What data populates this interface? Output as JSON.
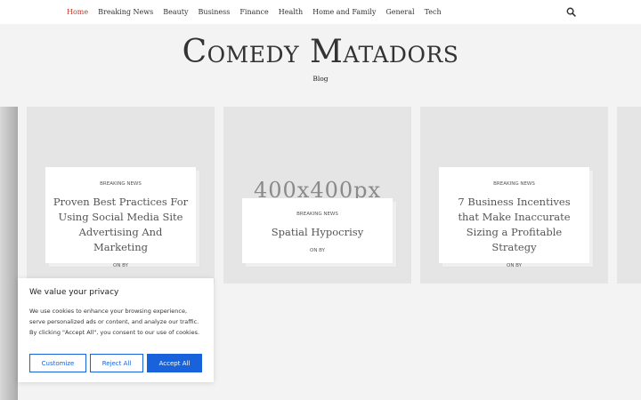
{
  "nav": {
    "items": [
      "Home",
      "Breaking News",
      "Beauty",
      "Business",
      "Finance",
      "Health",
      "Home and Family",
      "General",
      "Tech"
    ],
    "search_icon": "search-icon"
  },
  "site": {
    "title": "Comedy Matadors",
    "description": "Blog"
  },
  "posts": [
    {
      "category": "BREAKING NEWS",
      "title": "Proven Best Practices For Using Social Media Site Advertising And Marketing",
      "meta": "ON BY"
    },
    {
      "category": "BREAKING NEWS",
      "title": "Spatial Hypocrisy",
      "meta": "ON BY",
      "placeholder": "400x400px"
    },
    {
      "category": "BREAKING NEWS",
      "title": "7 Business Incentives that Make Inaccurate Sizing a Profitable Strategy",
      "meta": "ON BY"
    }
  ],
  "cookie": {
    "title": "We value your privacy",
    "text": "We use cookies to enhance your browsing experience, serve personalized ads or content, and analyze our traffic. By clicking \"Accept All\", you consent to our use of cookies.",
    "customize": "Customize",
    "reject": "Reject All",
    "accept": "Accept All"
  },
  "colors": {
    "active_nav": "#c0392b",
    "accent": "#1863dc",
    "card_bg": "#e5e5e5"
  }
}
